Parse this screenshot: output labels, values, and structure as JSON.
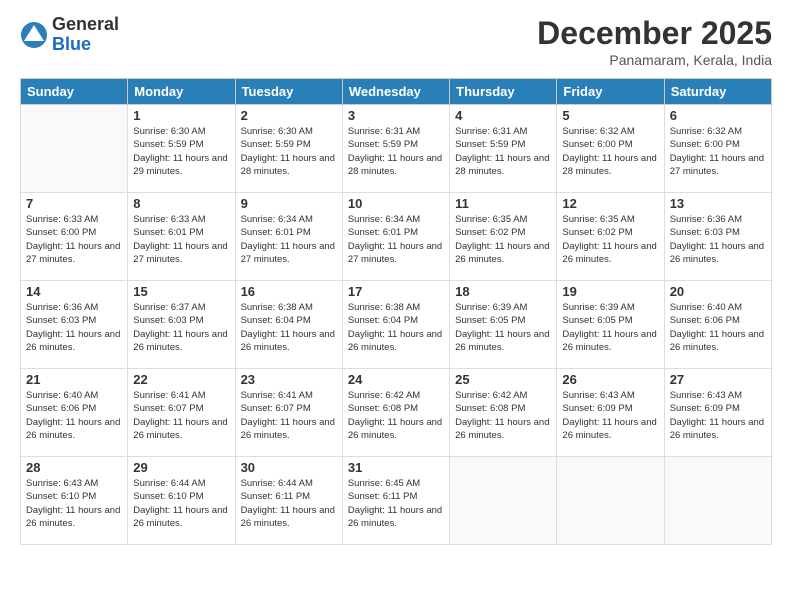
{
  "logo": {
    "general": "General",
    "blue": "Blue"
  },
  "title": "December 2025",
  "location": "Panamaram, Kerala, India",
  "weekdays": [
    "Sunday",
    "Monday",
    "Tuesday",
    "Wednesday",
    "Thursday",
    "Friday",
    "Saturday"
  ],
  "weeks": [
    [
      {
        "day": "",
        "sunrise": "",
        "sunset": "",
        "daylight": ""
      },
      {
        "day": "1",
        "sunrise": "Sunrise: 6:30 AM",
        "sunset": "Sunset: 5:59 PM",
        "daylight": "Daylight: 11 hours and 29 minutes."
      },
      {
        "day": "2",
        "sunrise": "Sunrise: 6:30 AM",
        "sunset": "Sunset: 5:59 PM",
        "daylight": "Daylight: 11 hours and 28 minutes."
      },
      {
        "day": "3",
        "sunrise": "Sunrise: 6:31 AM",
        "sunset": "Sunset: 5:59 PM",
        "daylight": "Daylight: 11 hours and 28 minutes."
      },
      {
        "day": "4",
        "sunrise": "Sunrise: 6:31 AM",
        "sunset": "Sunset: 5:59 PM",
        "daylight": "Daylight: 11 hours and 28 minutes."
      },
      {
        "day": "5",
        "sunrise": "Sunrise: 6:32 AM",
        "sunset": "Sunset: 6:00 PM",
        "daylight": "Daylight: 11 hours and 28 minutes."
      },
      {
        "day": "6",
        "sunrise": "Sunrise: 6:32 AM",
        "sunset": "Sunset: 6:00 PM",
        "daylight": "Daylight: 11 hours and 27 minutes."
      }
    ],
    [
      {
        "day": "7",
        "sunrise": "Sunrise: 6:33 AM",
        "sunset": "Sunset: 6:00 PM",
        "daylight": "Daylight: 11 hours and 27 minutes."
      },
      {
        "day": "8",
        "sunrise": "Sunrise: 6:33 AM",
        "sunset": "Sunset: 6:01 PM",
        "daylight": "Daylight: 11 hours and 27 minutes."
      },
      {
        "day": "9",
        "sunrise": "Sunrise: 6:34 AM",
        "sunset": "Sunset: 6:01 PM",
        "daylight": "Daylight: 11 hours and 27 minutes."
      },
      {
        "day": "10",
        "sunrise": "Sunrise: 6:34 AM",
        "sunset": "Sunset: 6:01 PM",
        "daylight": "Daylight: 11 hours and 27 minutes."
      },
      {
        "day": "11",
        "sunrise": "Sunrise: 6:35 AM",
        "sunset": "Sunset: 6:02 PM",
        "daylight": "Daylight: 11 hours and 26 minutes."
      },
      {
        "day": "12",
        "sunrise": "Sunrise: 6:35 AM",
        "sunset": "Sunset: 6:02 PM",
        "daylight": "Daylight: 11 hours and 26 minutes."
      },
      {
        "day": "13",
        "sunrise": "Sunrise: 6:36 AM",
        "sunset": "Sunset: 6:03 PM",
        "daylight": "Daylight: 11 hours and 26 minutes."
      }
    ],
    [
      {
        "day": "14",
        "sunrise": "Sunrise: 6:36 AM",
        "sunset": "Sunset: 6:03 PM",
        "daylight": "Daylight: 11 hours and 26 minutes."
      },
      {
        "day": "15",
        "sunrise": "Sunrise: 6:37 AM",
        "sunset": "Sunset: 6:03 PM",
        "daylight": "Daylight: 11 hours and 26 minutes."
      },
      {
        "day": "16",
        "sunrise": "Sunrise: 6:38 AM",
        "sunset": "Sunset: 6:04 PM",
        "daylight": "Daylight: 11 hours and 26 minutes."
      },
      {
        "day": "17",
        "sunrise": "Sunrise: 6:38 AM",
        "sunset": "Sunset: 6:04 PM",
        "daylight": "Daylight: 11 hours and 26 minutes."
      },
      {
        "day": "18",
        "sunrise": "Sunrise: 6:39 AM",
        "sunset": "Sunset: 6:05 PM",
        "daylight": "Daylight: 11 hours and 26 minutes."
      },
      {
        "day": "19",
        "sunrise": "Sunrise: 6:39 AM",
        "sunset": "Sunset: 6:05 PM",
        "daylight": "Daylight: 11 hours and 26 minutes."
      },
      {
        "day": "20",
        "sunrise": "Sunrise: 6:40 AM",
        "sunset": "Sunset: 6:06 PM",
        "daylight": "Daylight: 11 hours and 26 minutes."
      }
    ],
    [
      {
        "day": "21",
        "sunrise": "Sunrise: 6:40 AM",
        "sunset": "Sunset: 6:06 PM",
        "daylight": "Daylight: 11 hours and 26 minutes."
      },
      {
        "day": "22",
        "sunrise": "Sunrise: 6:41 AM",
        "sunset": "Sunset: 6:07 PM",
        "daylight": "Daylight: 11 hours and 26 minutes."
      },
      {
        "day": "23",
        "sunrise": "Sunrise: 6:41 AM",
        "sunset": "Sunset: 6:07 PM",
        "daylight": "Daylight: 11 hours and 26 minutes."
      },
      {
        "day": "24",
        "sunrise": "Sunrise: 6:42 AM",
        "sunset": "Sunset: 6:08 PM",
        "daylight": "Daylight: 11 hours and 26 minutes."
      },
      {
        "day": "25",
        "sunrise": "Sunrise: 6:42 AM",
        "sunset": "Sunset: 6:08 PM",
        "daylight": "Daylight: 11 hours and 26 minutes."
      },
      {
        "day": "26",
        "sunrise": "Sunrise: 6:43 AM",
        "sunset": "Sunset: 6:09 PM",
        "daylight": "Daylight: 11 hours and 26 minutes."
      },
      {
        "day": "27",
        "sunrise": "Sunrise: 6:43 AM",
        "sunset": "Sunset: 6:09 PM",
        "daylight": "Daylight: 11 hours and 26 minutes."
      }
    ],
    [
      {
        "day": "28",
        "sunrise": "Sunrise: 6:43 AM",
        "sunset": "Sunset: 6:10 PM",
        "daylight": "Daylight: 11 hours and 26 minutes."
      },
      {
        "day": "29",
        "sunrise": "Sunrise: 6:44 AM",
        "sunset": "Sunset: 6:10 PM",
        "daylight": "Daylight: 11 hours and 26 minutes."
      },
      {
        "day": "30",
        "sunrise": "Sunrise: 6:44 AM",
        "sunset": "Sunset: 6:11 PM",
        "daylight": "Daylight: 11 hours and 26 minutes."
      },
      {
        "day": "31",
        "sunrise": "Sunrise: 6:45 AM",
        "sunset": "Sunset: 6:11 PM",
        "daylight": "Daylight: 11 hours and 26 minutes."
      },
      {
        "day": "",
        "sunrise": "",
        "sunset": "",
        "daylight": ""
      },
      {
        "day": "",
        "sunrise": "",
        "sunset": "",
        "daylight": ""
      },
      {
        "day": "",
        "sunrise": "",
        "sunset": "",
        "daylight": ""
      }
    ]
  ]
}
